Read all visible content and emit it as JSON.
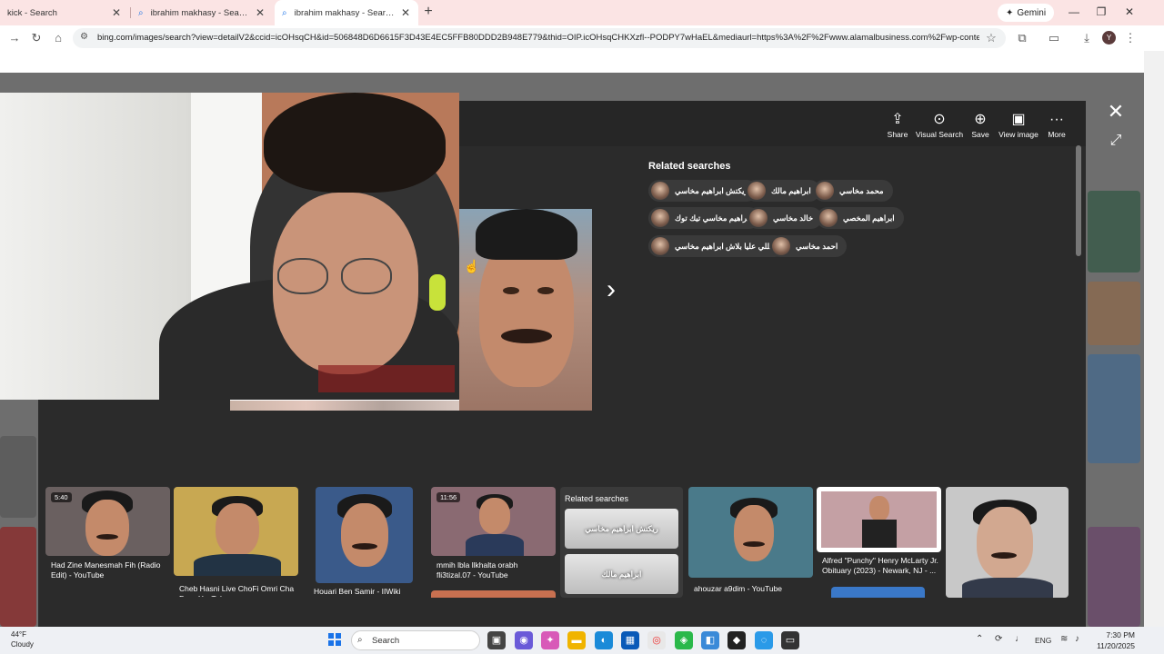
{
  "tabs": [
    {
      "title": "kick - Search"
    },
    {
      "title": "ibrahim makhasy - Search"
    },
    {
      "title": "ibrahim makhasy - Search Images"
    }
  ],
  "gemini_label": "Gemini",
  "address": {
    "url": "bing.com/images/search?view=detailV2&ccid=icOHsqCH&id=506848D6D6615F3D43E4EC5FFB80DDD2B948E779&thid=OIP.icOHsqCHKXzfl--PODPY7wHaEL&mediaurl=https%3A%2F%2Fwww.alamalbusiness.com%2Fwp-content%2Fu...",
    "avatar_letter": "Y"
  },
  "overlay": {
    "actions": [
      {
        "label": "Share",
        "icon": "share-icon"
      },
      {
        "label": "Visual Search",
        "icon": "visual-search-icon"
      },
      {
        "label": "Save",
        "icon": "save-icon"
      },
      {
        "label": "View image",
        "icon": "view-image-icon"
      },
      {
        "label": "More",
        "icon": "more-icon"
      }
    ],
    "related_title": "Related searches",
    "related": [
      "ريكتش ابراهيم مخاسي",
      "ابراهيم مالك",
      "محمد مخاسي",
      "ابراهيم مخاسي تيك توك",
      "خالد مخاسي",
      "ابراهيم المخصي",
      "يخللي عليا بلاش ابراهيم مخاسي",
      "احمد مخاسي"
    ]
  },
  "results": [
    {
      "caption": "Had Zine Manesmah Fih (Radio Edit) - YouTube",
      "duration": "5:40"
    },
    {
      "caption": "Cheb Hasni Live ChoFi Omri Cha Dra - YouTube",
      "duration": ""
    },
    {
      "caption": "Houari Ben Samir - IIWiki",
      "duration": ""
    },
    {
      "caption": "mmih lbla llkhalta orabh fli3tizal.07 - YouTube",
      "duration": "11:56"
    },
    {
      "caption": "ahouzar a9dim - YouTube",
      "duration": ""
    },
    {
      "caption": "Alfred \"Punchy\" Henry McLarty Jr. Obituary (2023) - Newark, NJ - ...",
      "duration": ""
    }
  ],
  "related_box": {
    "title": "Related searches",
    "items": [
      "ريكتش ابراهيم مخاسي",
      "ابراهيم مالك"
    ]
  },
  "taskbar": {
    "temp": "44°F",
    "weather": "Cloudy",
    "search": "Search",
    "lang": "ENG",
    "time": "7:30 PM",
    "date": "11/20/2025"
  }
}
